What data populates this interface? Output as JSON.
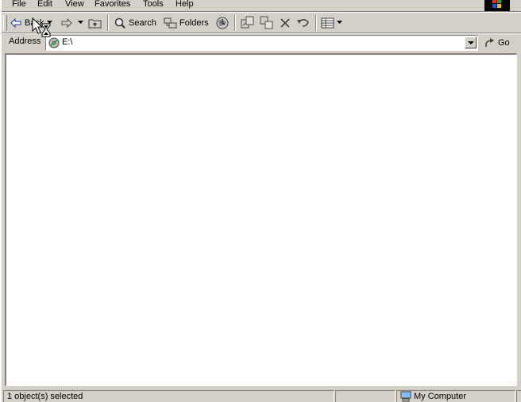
{
  "menu": {
    "file": "File",
    "edit": "Edit",
    "view": "View",
    "favorites": "Favorites",
    "tools": "Tools",
    "help": "Help"
  },
  "toolbar": {
    "back_label": "Back",
    "search_label": "Search",
    "folders_label": "Folders"
  },
  "address": {
    "label": "Address",
    "value": "E:\\",
    "go_label": "Go"
  },
  "status": {
    "selection": "1 object(s) selected",
    "location": "My Computer"
  },
  "icons": {
    "back": "back-arrow-icon",
    "forward": "forward-arrow-icon",
    "up": "up-folder-icon",
    "search": "search-icon",
    "folders": "folders-icon",
    "history": "history-icon",
    "move_to": "move-to-icon",
    "copy_to": "copy-to-icon",
    "delete": "delete-icon",
    "undo": "undo-icon",
    "views": "views-icon",
    "drive": "drive-icon",
    "go": "go-arrow-icon",
    "computer": "computer-icon",
    "cursor": "busy-cursor-icon",
    "windows_logo": "windows-logo-icon"
  },
  "colors": {
    "chrome": "#d4d0c8",
    "shadow": "#808080",
    "highlight": "#ffffff",
    "content_bg": "#ffffff"
  }
}
